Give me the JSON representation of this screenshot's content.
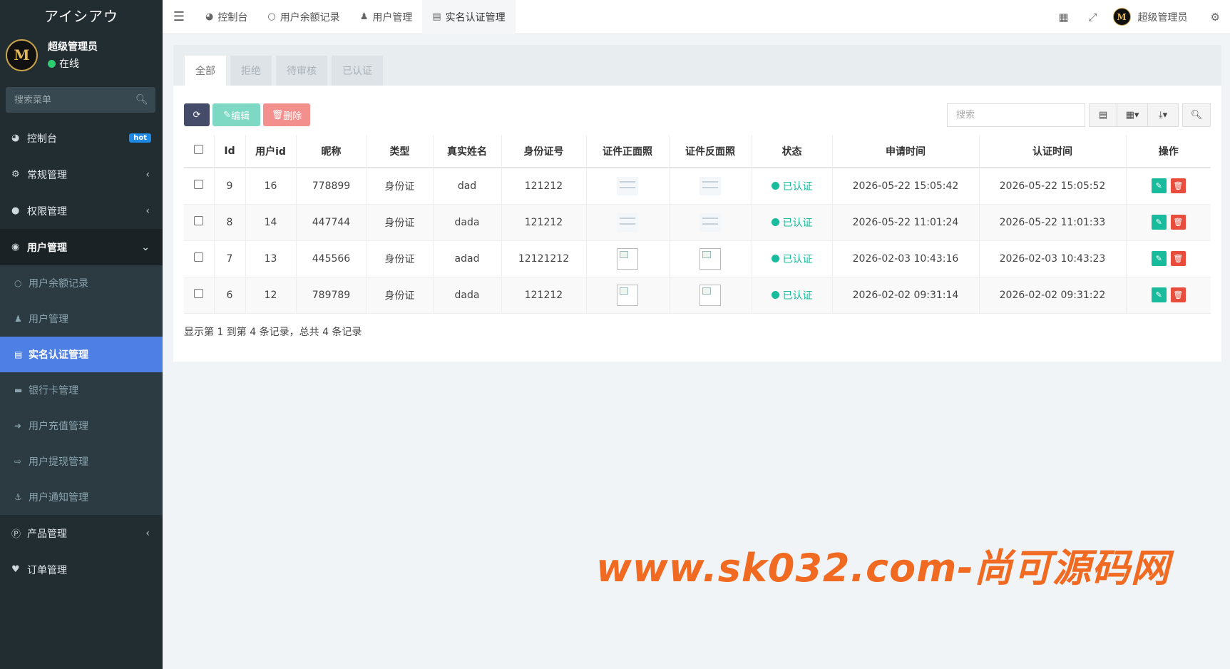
{
  "app": {
    "brand": "アイシアウ"
  },
  "user": {
    "name": "超级管理员",
    "status": "在线",
    "avatar_letter": "M",
    "top_name": "超级管理员"
  },
  "sidebar": {
    "search_placeholder": "搜索菜单",
    "items": [
      {
        "icon": "dashboard-icon",
        "label": "控制台",
        "badge": "hot"
      },
      {
        "icon": "cogs-icon",
        "label": "常规管理"
      },
      {
        "icon": "users-icon",
        "label": "权限管理"
      },
      {
        "icon": "user-circle-icon",
        "label": "用户管理"
      },
      {
        "icon": "product-icon",
        "label": "产品管理"
      },
      {
        "icon": "heartbeat-icon",
        "label": "订单管理"
      }
    ],
    "sub_items": [
      {
        "icon": "circle-icon",
        "label": "用户余额记录"
      },
      {
        "icon": "user-icon",
        "label": "用户管理"
      },
      {
        "icon": "id-card-icon",
        "label": "实名认证管理"
      },
      {
        "icon": "credit-card-icon",
        "label": "银行卡管理"
      },
      {
        "icon": "sign-in-icon",
        "label": "用户充值管理"
      },
      {
        "icon": "sign-out-icon",
        "label": "用户提现管理"
      },
      {
        "icon": "anchor-icon",
        "label": "用户通知管理"
      }
    ]
  },
  "topbar": {
    "tabs": [
      {
        "icon": "dashboard-icon",
        "label": "控制台"
      },
      {
        "icon": "circle-icon",
        "label": "用户余额记录"
      },
      {
        "icon": "user-icon",
        "label": "用户管理"
      },
      {
        "icon": "id-card-icon",
        "label": "实名认证管理"
      }
    ]
  },
  "panel": {
    "tabs": [
      "全部",
      "拒绝",
      "待审核",
      "已认证"
    ],
    "toolbar": {
      "edit": "编辑",
      "delete": "删除",
      "search_placeholder": "搜索"
    },
    "columns": [
      "Id",
      "用户id",
      "昵称",
      "类型",
      "真实姓名",
      "身份证号",
      "证件正面照",
      "证件反面照",
      "状态",
      "申请时间",
      "认证时间",
      "操作"
    ],
    "rows": [
      {
        "id": "9",
        "user_id": "16",
        "nickname": "778899",
        "type": "身份证",
        "real_name": "dad",
        "id_no": "121212",
        "status": "已认证",
        "apply_time": "2026-05-22 15:05:42",
        "cert_time": "2026-05-22 15:05:52"
      },
      {
        "id": "8",
        "user_id": "14",
        "nickname": "447744",
        "type": "身份证",
        "real_name": "dada",
        "id_no": "121212",
        "status": "已认证",
        "apply_time": "2026-05-22 11:01:24",
        "cert_time": "2026-05-22 11:01:33"
      },
      {
        "id": "7",
        "user_id": "13",
        "nickname": "445566",
        "type": "身份证",
        "real_name": "adad",
        "id_no": "12121212",
        "status": "已认证",
        "apply_time": "2026-02-03 10:43:16",
        "cert_time": "2026-02-03 10:43:23"
      },
      {
        "id": "6",
        "user_id": "12",
        "nickname": "789789",
        "type": "身份证",
        "real_name": "dada",
        "id_no": "121212",
        "status": "已认证",
        "apply_time": "2026-02-02 09:31:14",
        "cert_time": "2026-02-02 09:31:22"
      }
    ],
    "footer": "显示第 1 到第 4 条记录，总共 4 条记录"
  },
  "watermark": "www.sk032.com-尚可源码网",
  "colors": {
    "sidebar_bg": "#222d32",
    "active_menu": "#4e7fe5",
    "success": "#18bc9c",
    "danger": "#e74c3c",
    "watermark": "#f06a22"
  }
}
